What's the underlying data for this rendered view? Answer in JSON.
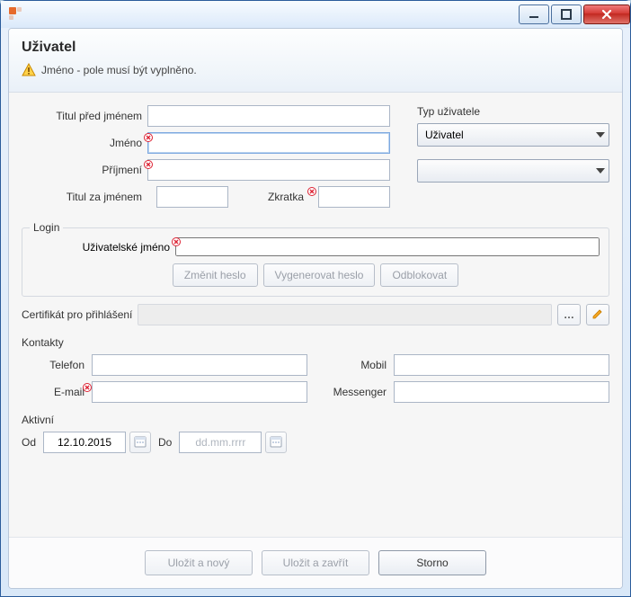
{
  "header": {
    "title": "Uživatel",
    "validation_message": "Jméno - pole musí být vyplněno."
  },
  "labels": {
    "title_before": "Titul před jménem",
    "first_name": "Jméno",
    "last_name": "Příjmení",
    "title_after": "Titul za jménem",
    "abbrev": "Zkratka",
    "login_group": "Login",
    "username": "Uživatelské jméno",
    "change_password": "Změnit heslo",
    "generate_password": "Vygenerovat heslo",
    "unlock": "Odblokovat",
    "cert_login": "Certifikát pro přihlášení",
    "user_type": "Typ uživatele",
    "contacts_group": "Kontakty",
    "phone": "Telefon",
    "mobile": "Mobil",
    "email": "E-mail",
    "messenger": "Messenger",
    "active_group": "Aktivní",
    "from": "Od",
    "to": "Do"
  },
  "values": {
    "title_before": "",
    "first_name": "",
    "last_name": "",
    "title_after": "",
    "abbrev": "",
    "username": "",
    "user_type_selected": "Uživatel",
    "second_select": "",
    "phone": "",
    "mobile": "",
    "email": "",
    "messenger": "",
    "active_from": "12.10.2015",
    "active_to": ""
  },
  "placeholders": {
    "active_to": "dd.mm.rrrr"
  },
  "footer": {
    "save_and_new": "Uložit a nový",
    "save_and_close": "Uložit a zavřít",
    "cancel": "Storno"
  }
}
